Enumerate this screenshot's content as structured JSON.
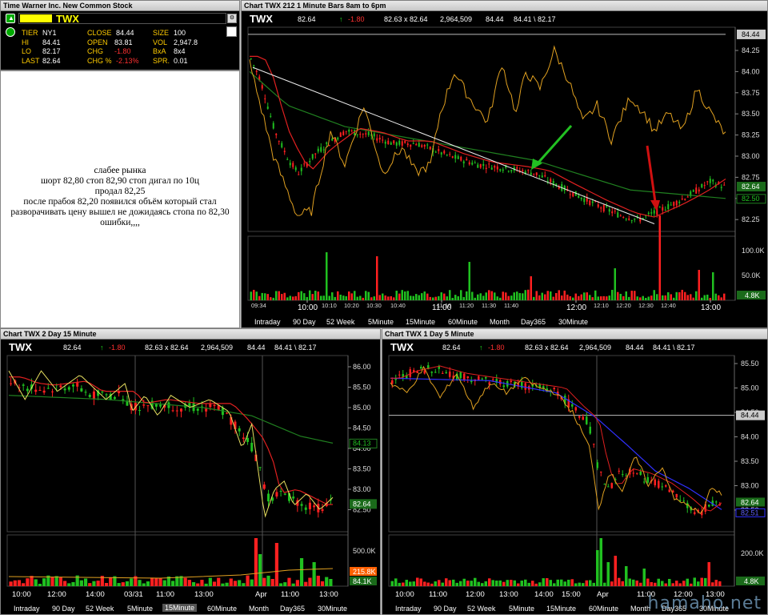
{
  "quote": {
    "title": "Time Warner Inc. New Common Stock",
    "symbol": "TWX",
    "fields": [
      {
        "l": "TIER",
        "v": "NY1"
      },
      {
        "l": "CLOSE",
        "v": "84.44"
      },
      {
        "l": "SIZE",
        "v": "100"
      },
      {
        "l": "HI",
        "v": "84.41"
      },
      {
        "l": "OPEN",
        "v": "83.81"
      },
      {
        "l": "VOL",
        "v": "2,947.8"
      },
      {
        "l": "LO",
        "v": "82.17"
      },
      {
        "l": "CHG",
        "v": "-1.80"
      },
      {
        "l": "BxA",
        "v": "8x4"
      },
      {
        "l": "LAST",
        "v": "82.64"
      },
      {
        "l": "CHG %",
        "v": "-2.13%"
      },
      {
        "l": "SPR.",
        "v": "0.01"
      }
    ]
  },
  "notes": {
    "line1": "слабее рынка",
    "line2": "шорт 82,80 стоп 82,90  стоп дигал по 10ц",
    "line3": "продал 82,25",
    "line4": "после прабоя 82,20 появился объём который стал",
    "line5": "разворачивать цену вышел не дожидаясь стопа по 82,30",
    "line6": "ошибки,,,,"
  },
  "chart_main": {
    "title": "Chart TWX 212 1 Minute Bars 8am to 6pm",
    "ticker": "TWX",
    "last": "82.64",
    "chg": "-1.80",
    "bidask": "82.63 x 82.64",
    "volume": "2,964,509",
    "close": "84.44",
    "hilo": "84.41 \\ 82.17",
    "price_labels": [
      "84.25",
      "84.00",
      "83.75",
      "83.50",
      "83.25",
      "83.00",
      "82.75",
      "82.50",
      "82.25"
    ],
    "tag_close": "84.44",
    "tag_last": "82.64",
    "tag_ma": "82.50",
    "vol_labels": [
      "100.0K",
      "50.0K"
    ],
    "vol_tag": "4.8K",
    "time_labels_small": [
      "09:34",
      "10:10",
      "10:20",
      "10:30",
      "10:40",
      "11:10",
      "11:20",
      "11:30",
      "11:40",
      "12:10",
      "12:20",
      "12:30",
      "12:40"
    ],
    "time_labels_big": [
      "10:00",
      "11:00",
      "12:00",
      "13:00"
    ],
    "tabs": [
      "Intraday",
      "90 Day",
      "52 Week",
      "5Minute",
      "15Minute",
      "60Minute",
      "Month",
      "Day365",
      "30Minute"
    ]
  },
  "chart_2day": {
    "title": "Chart TWX 2 Day 15 Minute",
    "ticker": "TWX",
    "last": "82.64",
    "chg": "-1.80",
    "bidask": "82.63 x 82.64",
    "volume": "2,964,509",
    "close": "84.44",
    "hilo": "84.41 \\ 82.17",
    "price_labels": [
      "86.00",
      "85.50",
      "85.00",
      "84.50",
      "84.00",
      "83.50",
      "83.00",
      "82.50"
    ],
    "tag_ma": "84.13",
    "tag_last": "82.64",
    "vol_labels": [
      "500.0K"
    ],
    "vol_tag1": "215.8K",
    "vol_tag2": "84.1K",
    "time_labels": [
      "10:00",
      "12:00",
      "14:00",
      "03/31",
      "11:00",
      "13:00",
      "Apr",
      "11:00",
      "13:00"
    ],
    "tabs": [
      "Intraday",
      "90 Day",
      "52 Week",
      "5Minute",
      "15Minute",
      "60Minute",
      "Month",
      "Day365",
      "30Minute"
    ]
  },
  "chart_1day": {
    "title": "Chart TWX 1 Day 5 Minute",
    "ticker": "TWX",
    "last": "82.64",
    "chg": "-1.80",
    "bidask": "82.63 x 82.64",
    "volume": "2,964,509",
    "close": "84.44",
    "hilo": "84.41 \\ 82.17",
    "price_labels": [
      "85.50",
      "85.00",
      "84.50",
      "84.00",
      "83.50",
      "83.00",
      "82.50"
    ],
    "tag_close": "84.44",
    "tag_last": "82.64",
    "tag_ma": "82.51",
    "vol_labels": [
      "200.0K"
    ],
    "vol_tag": "4.8K",
    "time_labels": [
      "10:00",
      "11:00",
      "12:00",
      "13:00",
      "14:00",
      "15:00",
      "Apr",
      "11:00",
      "12:00",
      "13:00"
    ],
    "tabs": [
      "Intraday",
      "90 Day",
      "52 Week",
      "5Minute",
      "15Minute",
      "60Minute",
      "Month",
      "Day365",
      "30Minute"
    ]
  },
  "watermark": "hamaho.net",
  "colors": {
    "up": "#20c020",
    "down": "#ff2020",
    "ma_fast": "#e02020",
    "ma_slow": "#208020",
    "osc": "#e0a020",
    "ma_blue": "#3030ff"
  }
}
